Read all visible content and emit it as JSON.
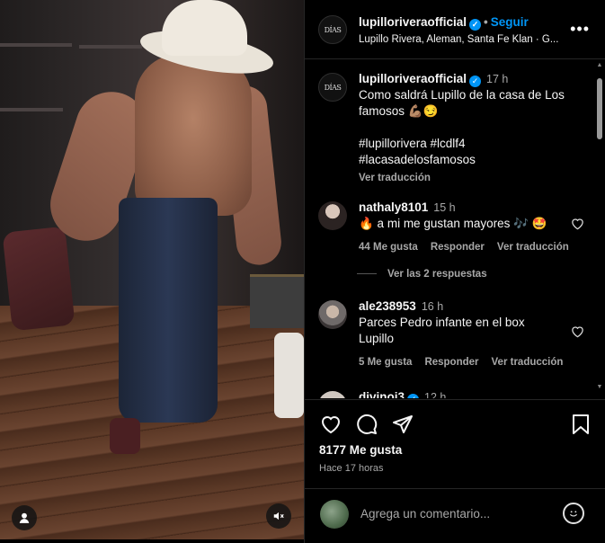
{
  "header": {
    "logo_text": "DÍAS",
    "username": "lupilloriveraofficial",
    "separator": "•",
    "follow_label": "Seguir",
    "subline": "Lupillo Rivera, Aleman, Santa Fe Klan · G...",
    "more_label": "•••"
  },
  "caption": {
    "username": "lupilloriveraofficial",
    "time": "17 h",
    "text_line1": "Como saldrá Lupillo de la casa de Los famosos 💪🏽😏",
    "hashtags_line1": "#lupillorivera #lcdlf4",
    "hashtags_line2": "#lacasadelosfamosos",
    "translate_label": "Ver traducción"
  },
  "comments": [
    {
      "username": "nathaly8101",
      "time": "15 h",
      "text": "🔥 a mi me gustan mayores 🎶 🤩",
      "likes": "44 Me gusta",
      "reply_label": "Responder",
      "translate_label": "Ver traducción"
    },
    {
      "username": "ale238953",
      "time": "16 h",
      "text": "Parces Pedro infante en el box Lupillo",
      "likes": "5 Me gusta",
      "reply_label": "Responder",
      "translate_label": "Ver traducción"
    },
    {
      "username": "divinoj3",
      "time": "12 h"
    }
  ],
  "view_replies_label": "Ver las 2 respuestas",
  "stats": {
    "likes": "8177 Me gusta",
    "posted_ago": "Hace 17 horas"
  },
  "add_comment": {
    "placeholder": "Agrega un comentario..."
  },
  "icons": {
    "like": "heart-icon",
    "comment": "comment-icon",
    "share": "share-icon",
    "save": "bookmark-icon",
    "verified": "verified-badge-icon",
    "mute": "muted-speaker-icon",
    "tags": "user-tag-icon",
    "emoji": "emoji-icon"
  },
  "colors": {
    "accent": "#0095f6",
    "background": "#000000",
    "muted_text": "#a8a8a8"
  }
}
